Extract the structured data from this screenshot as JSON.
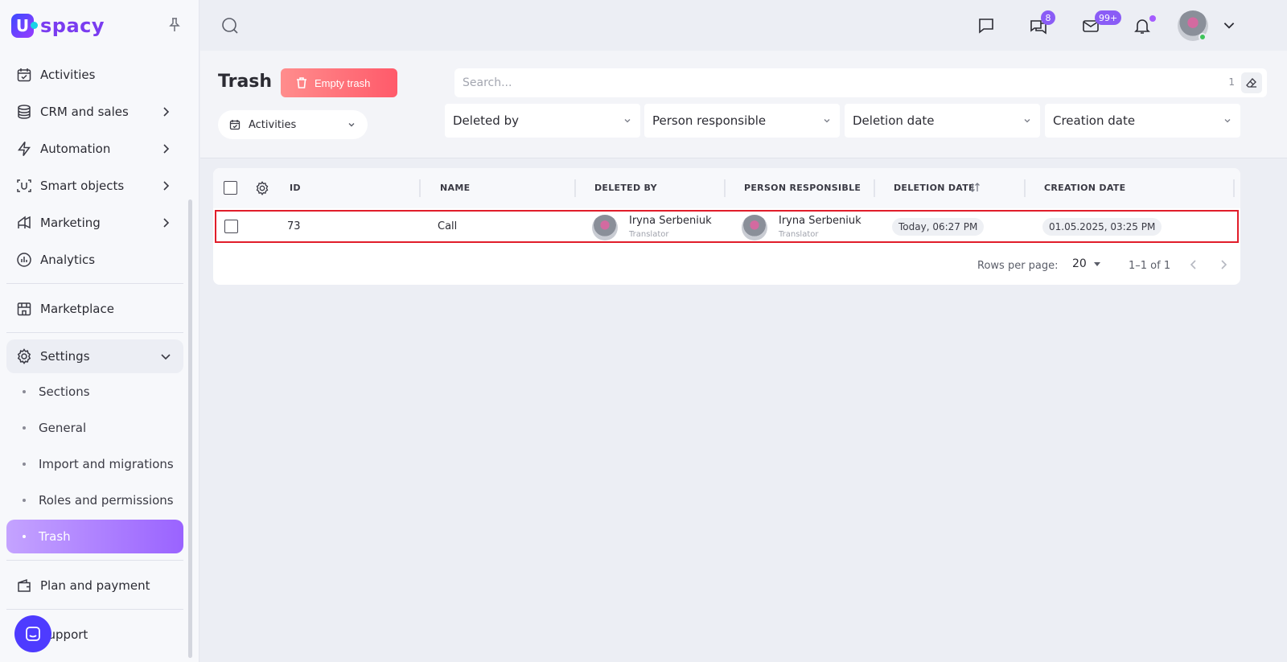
{
  "brand": {
    "name": "spacy",
    "mark": "U"
  },
  "sidebar": {
    "items": [
      {
        "label": "Activities",
        "icon": "calendar-check-icon"
      },
      {
        "label": "CRM and sales",
        "icon": "database-icon"
      },
      {
        "label": "Automation",
        "icon": "lightning-icon"
      },
      {
        "label": "Smart objects",
        "icon": "smart-object-icon"
      },
      {
        "label": "Marketing",
        "icon": "megaphone-icon"
      },
      {
        "label": "Analytics",
        "icon": "chart-circle-icon"
      },
      {
        "label": "Marketplace",
        "icon": "store-icon"
      },
      {
        "label": "Settings",
        "icon": "gear-icon"
      },
      {
        "label": "Plan and payment",
        "icon": "wallet-icon"
      },
      {
        "label": "Support",
        "icon": "chat-icon"
      }
    ],
    "settings_sub": [
      {
        "label": "Sections"
      },
      {
        "label": "General"
      },
      {
        "label": "Import and migrations"
      },
      {
        "label": "Roles and permissions"
      },
      {
        "label": "Trash"
      }
    ]
  },
  "topbar": {
    "chat_badge": "8",
    "mail_badge": "99+"
  },
  "header": {
    "title": "Trash",
    "empty_label": "Empty trash",
    "entity_select": "Activities",
    "search_placeholder": "Search...",
    "search_count": "1",
    "filters": [
      "Deleted by",
      "Person responsible",
      "Deletion date",
      "Creation date"
    ]
  },
  "table": {
    "columns": [
      "ID",
      "NAME",
      "DELETED BY",
      "PERSON RESPONSIBLE",
      "DELETION DATE",
      "CREATION DATE"
    ],
    "rows": [
      {
        "id": "73",
        "name": "Call",
        "deleted_by": {
          "name": "Iryna Serbeniuk",
          "role": "Translator"
        },
        "responsible": {
          "name": "Iryna Serbeniuk",
          "role": "Translator"
        },
        "deletion_date": "Today, 06:27 PM",
        "creation_date": "01.05.2025, 03:25 PM"
      }
    ]
  },
  "pagination": {
    "rows_per_page_label": "Rows per page:",
    "rows_per_page": "20",
    "range": "1–1 of 1"
  },
  "colors": {
    "accent": "#8a5cf6",
    "danger": "#ff5a6a",
    "highlight": "#e11d2a"
  }
}
